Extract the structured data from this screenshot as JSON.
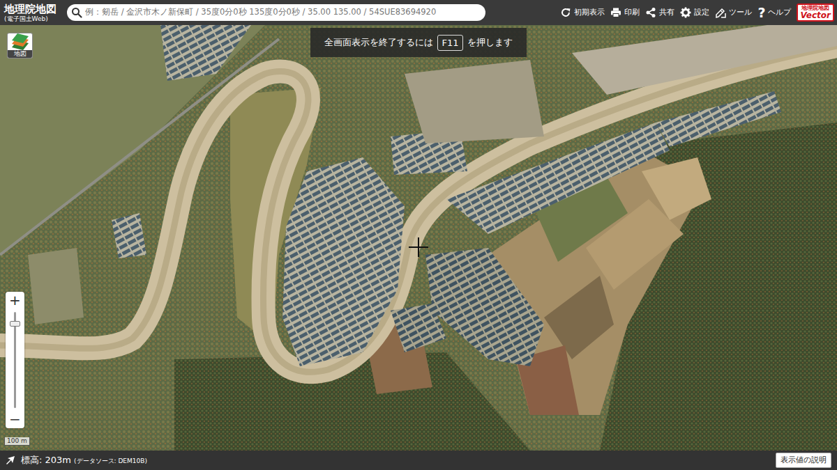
{
  "app": {
    "title": "地理院地図",
    "subtitle": "(電子国土Web)"
  },
  "search": {
    "placeholder": "例：剱岳 / 金沢市木ノ新保町 / 35度0分0秒 135度0分0秒 / 35.00 135.00 / 54SUE83694920"
  },
  "toolbar": [
    {
      "label": "初期表示"
    },
    {
      "label": "印刷"
    },
    {
      "label": "共有"
    },
    {
      "label": "設定"
    },
    {
      "label": "ツール"
    },
    {
      "label": "ヘルプ",
      "glyph": "?"
    }
  ],
  "badge": {
    "line1": "地理院地図",
    "line2": "Vector"
  },
  "notice": {
    "before": "全画面表示を終了するには",
    "key": "F11",
    "after": "を押します"
  },
  "layer_button": {
    "label": "地図"
  },
  "zoom": {
    "plus": "+",
    "minus": "−",
    "level": 0.88
  },
  "scale": {
    "label": "100 m"
  },
  "status_bar": {
    "elevation": "標高: 203m",
    "source": "(データソース: DEM10B)",
    "help_button": "表示値の説明"
  }
}
